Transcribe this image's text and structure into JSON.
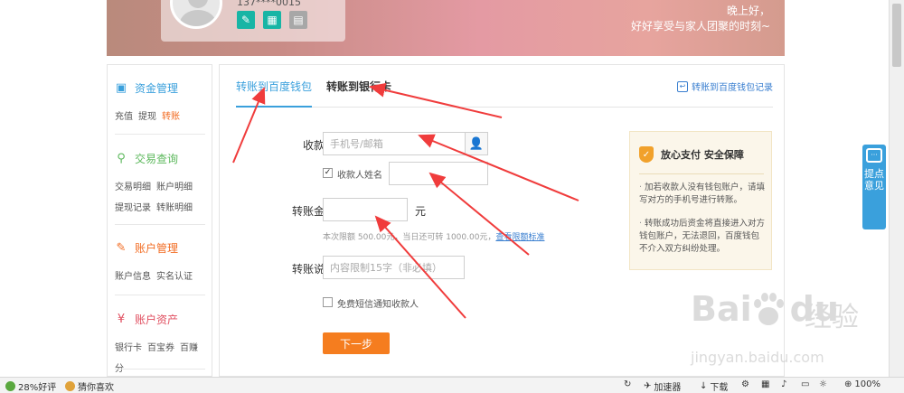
{
  "header": {
    "phone": "137****0015",
    "greeting_line1": "晚上好，",
    "greeting_line2": "好好享受与家人团聚的时刻~",
    "icons": [
      "edit-icon",
      "calculator-icon",
      "id-card-icon"
    ]
  },
  "sidebar": {
    "sections": [
      {
        "title": "资金管理",
        "icon": "wallet-icon",
        "links": [
          "充值",
          "提现",
          "转账"
        ],
        "active": "转账"
      },
      {
        "title": "交易查询",
        "icon": "search-icon",
        "links": [
          "交易明细",
          "账户明细",
          "提现记录",
          "转账明细"
        ]
      },
      {
        "title": "账户管理",
        "icon": "edit-icon",
        "links": [
          "账户信息",
          "实名认证"
        ]
      },
      {
        "title": "账户资产",
        "icon": "yuan-icon",
        "links": [
          "银行卡",
          "百宝券",
          "百赚分"
        ]
      }
    ]
  },
  "tabs": {
    "items": [
      "转账到百度钱包",
      "转账到银行卡"
    ],
    "active": "转账到百度钱包",
    "record_link": "转账到百度钱包记录"
  },
  "form": {
    "payee_label": "收款人",
    "payee_placeholder": "手机号/邮箱",
    "payee_name_label": "收款人姓名",
    "payee_name_checked": true,
    "amount_label": "转账金额",
    "amount_unit": "元",
    "amount_hint": "本次限额 500.00元，当日还可转 1000.00元，",
    "amount_hint_link": "查看限额标准",
    "note_label": "转账说明",
    "note_placeholder": "内容限制15字（非必填）",
    "sms_notify_label": "免费短信通知收款人",
    "sms_notify_checked": false,
    "submit": "下一步"
  },
  "notice": {
    "title": "放心支付 安全保障",
    "items": [
      "加若收款人没有钱包账户，请填写对方的手机号进行转账。",
      "转账成功后资金将直接进入对方钱包账户，无法退回，百度钱包不介入双方纠纷处理。"
    ]
  },
  "feedback": {
    "label": "提点意见"
  },
  "watermark": {
    "logo": "Bai",
    "logo2": "du",
    "cn": "经验",
    "url": "jingyan.baidu.com"
  },
  "statusbar": {
    "rating": "28%好评",
    "guess": "猜你喜欢",
    "accelerator": "加速器",
    "download": "下载",
    "zoom": "100%"
  },
  "colors": {
    "accent": "#3aa0dc",
    "orange": "#f57d1f",
    "arrow": "#f03c3c"
  }
}
